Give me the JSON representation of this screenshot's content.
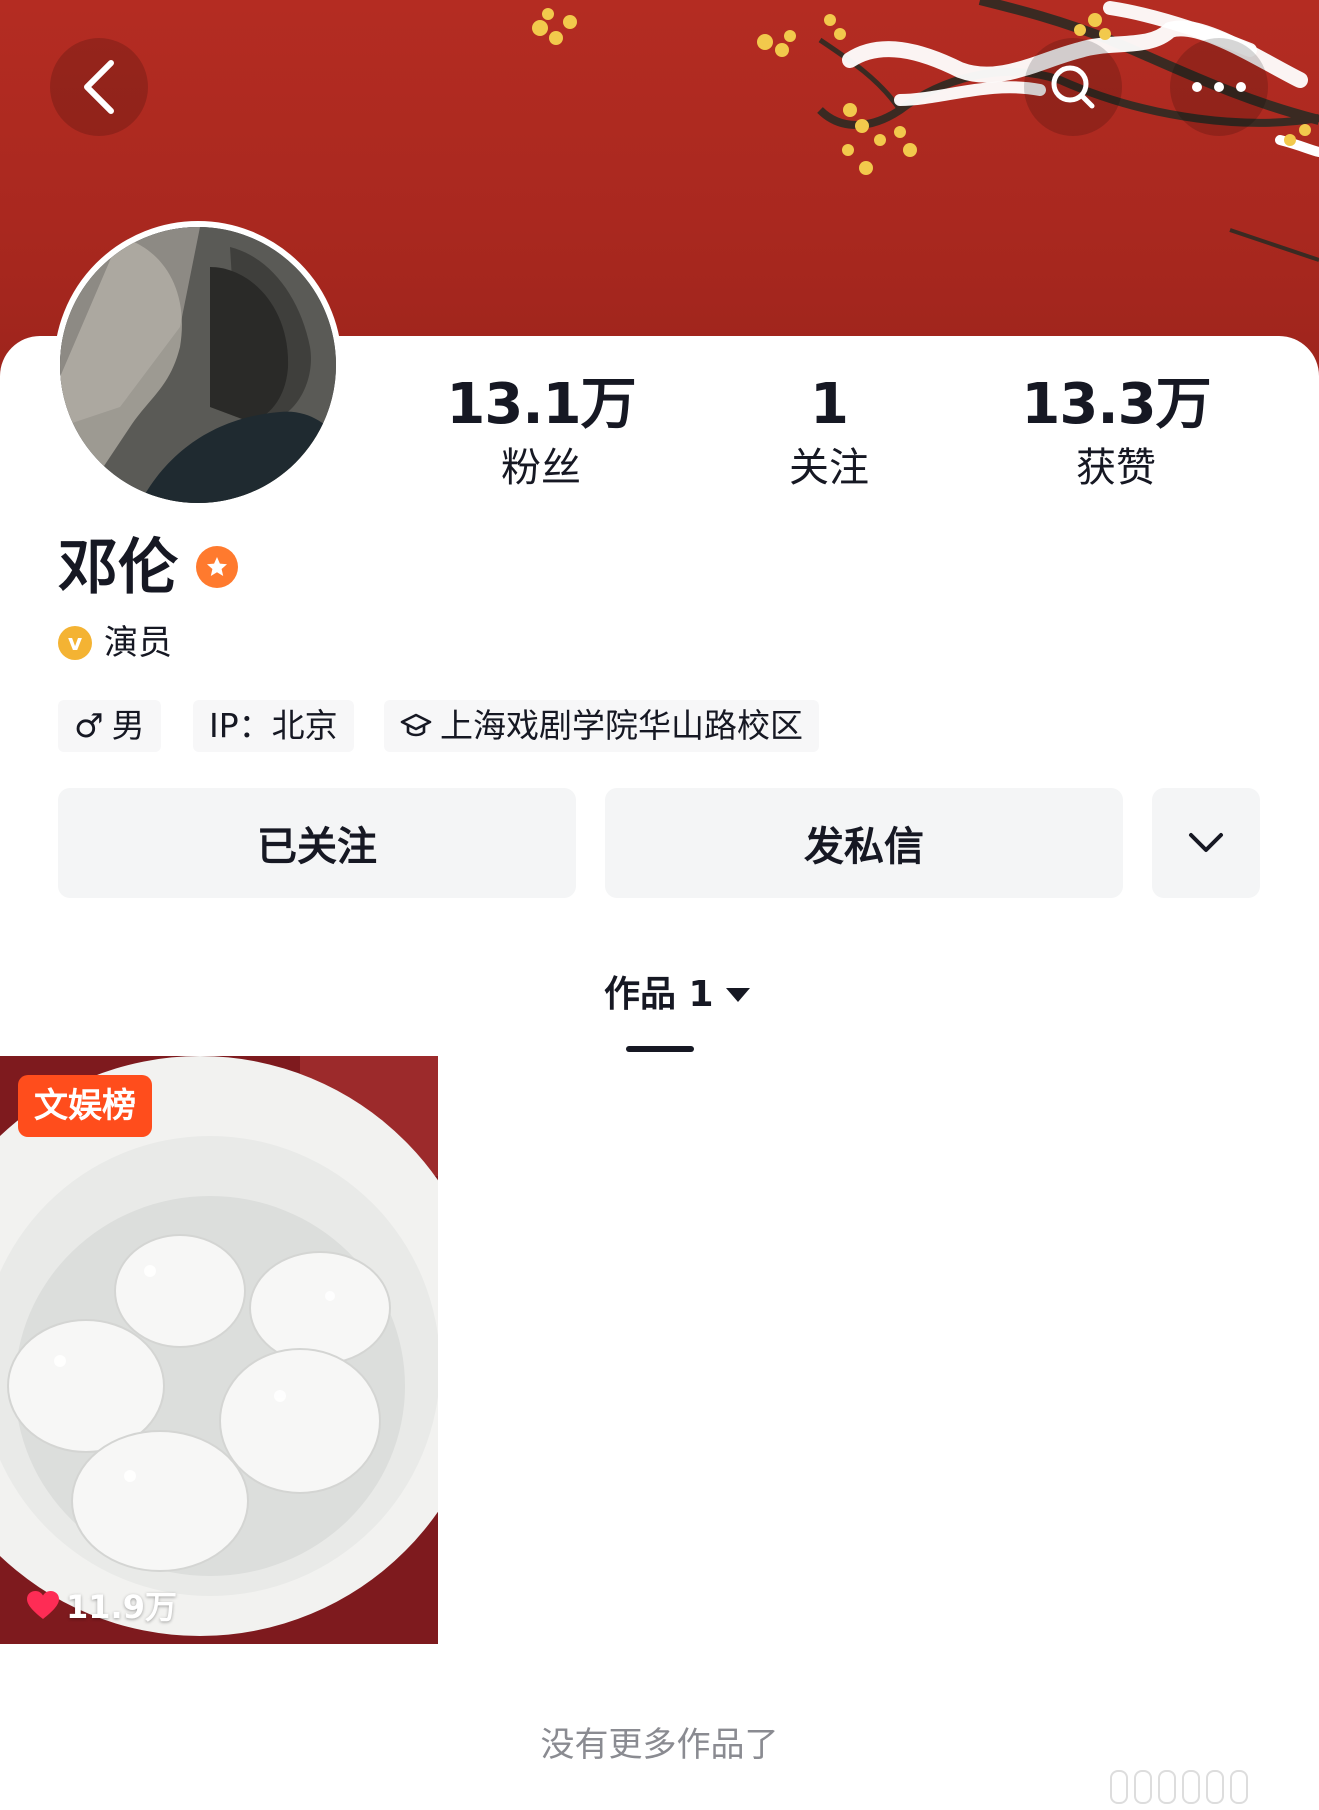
{
  "profile": {
    "name": "邓伦",
    "verified_title": "演员",
    "verified_icon_letter": "v",
    "stats": [
      {
        "value": "13.1万",
        "label": "粉丝"
      },
      {
        "value": "1",
        "label": "关注"
      },
      {
        "value": "13.3万",
        "label": "获赞"
      }
    ],
    "tags": {
      "gender_symbol": "♂",
      "gender": "男",
      "ip": "IP：北京",
      "school": "上海戏剧学院华山路校区"
    }
  },
  "actions": {
    "following_label": "已关注",
    "message_label": "发私信"
  },
  "tabs": {
    "works_label": "作品 1"
  },
  "works": [
    {
      "badge": "文娱榜",
      "likes": "11.9万"
    }
  ],
  "footer": {
    "no_more_text": "没有更多作品了"
  },
  "icons": {
    "back": "back-arrow-icon",
    "search": "search-icon",
    "more": "more-icon",
    "badge": "star-badge-icon",
    "school": "graduation-cap-icon",
    "dropdown": "chevron-down-icon",
    "sort": "triangle-down-icon",
    "like": "heart-icon"
  },
  "colors": {
    "banner": "#a9281f",
    "accent_orange": "#ff7a2e",
    "badge_red": "#ff4d1c",
    "verify_gold": "#f4b333",
    "like_red": "#fe2c55"
  }
}
